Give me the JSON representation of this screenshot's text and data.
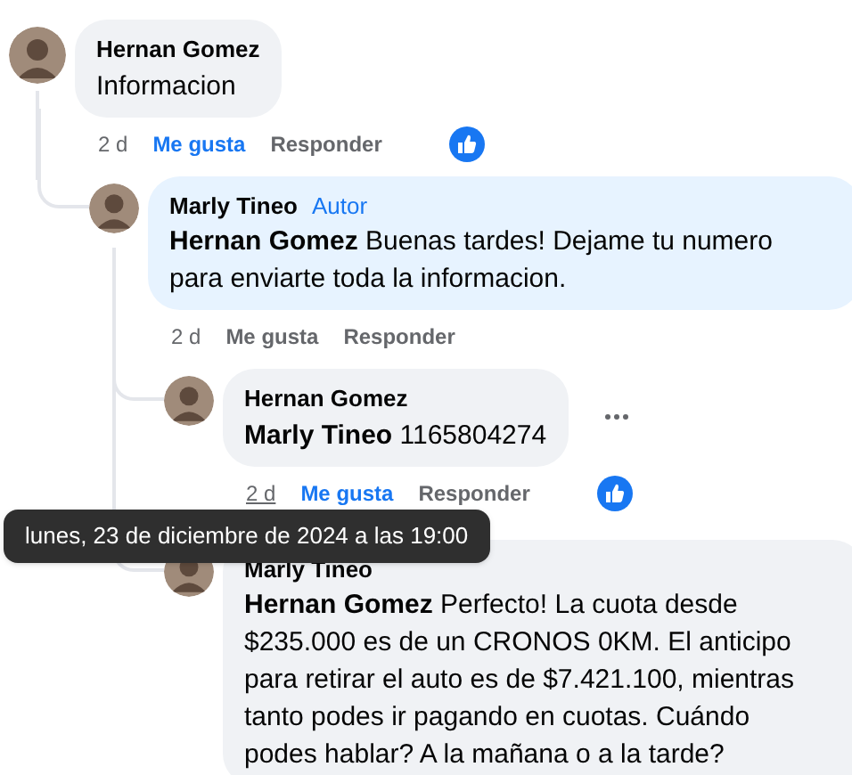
{
  "comments": [
    {
      "author": "Hernan Gomez",
      "text": "Informacion",
      "highlighted": false,
      "time": "2 d",
      "time_hovered": false,
      "like_label": "Me gusta",
      "liked": true,
      "reply_label": "Responder",
      "has_reaction": true,
      "children": [
        {
          "author": "Marly Tineo",
          "badge": "Autor",
          "text": "**Hernan Gomez** Buenas tardes! Dejame tu numero para enviarte toda la informacion.",
          "highlighted": true,
          "time": "2 d",
          "time_hovered": false,
          "like_label": "Me gusta",
          "liked": false,
          "reply_label": "Responder",
          "children": [
            {
              "author": "Hernan Gomez",
              "text": "**Marly Tineo** 1165804274",
              "highlighted": false,
              "time": "2 d",
              "time_hovered": true,
              "like_label": "Me gusta",
              "liked": true,
              "reply_label": "Responder",
              "has_reaction": true,
              "show_menu": true
            },
            {
              "author": "Marly Tineo",
              "text": "**Hernan Gomez** Perfecto! La cuota desde $235.000 es de un CRONOS 0KM. El anticipo para retirar el auto es de $7.421.100, mientras tanto podes ir pagando en cuotas. Cuándo podes hablar? A la mañana o a la tarde?",
              "highlighted": false
            }
          ]
        }
      ]
    }
  ],
  "tooltip": {
    "text": "lunes, 23 de diciembre de 2024 a las 19:00"
  }
}
